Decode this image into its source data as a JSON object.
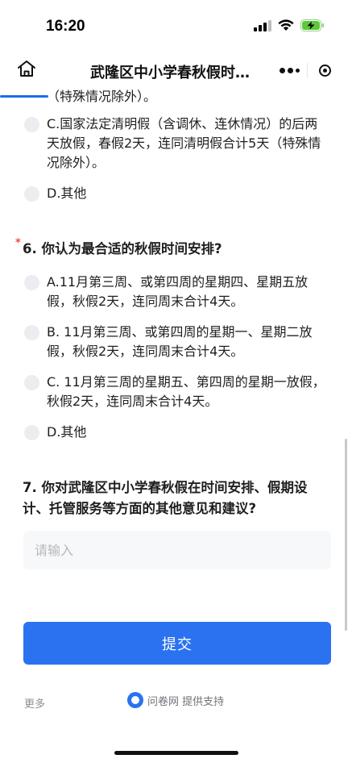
{
  "status_bar": {
    "time": "16:20",
    "signal_icon": "cellular-signal-icon",
    "wifi_icon": "wifi-icon",
    "battery_icon": "battery-charging-icon"
  },
  "nav": {
    "title": "武隆区中小学春秋假时…",
    "home_icon": "home-icon",
    "more_icon": "more-dots-icon",
    "close_icon": "mini-program-close-icon"
  },
  "q5_partial": {
    "option_b_tail": "（特殊情况除外）。",
    "option_c": "C.国家法定清明假（含调休、连休情况）的后两天放假，春假2天，连同清明假合计5天（特殊情况除外）。",
    "option_d": "D.其他"
  },
  "q6": {
    "required_mark": "*",
    "title": "6. 你认为最合适的秋假时间安排?",
    "options": [
      "A.11月第三周、或第四周的星期四、星期五放假，秋假2天，连同周末合计4天。",
      "B. 11月第三周、或第四周的星期一、星期二放假，秋假2天，连同周末合计4天。",
      "C. 11月第三周的星期五、第四周的星期一放假，秋假2天，连同周末合计4天。",
      "D.其他"
    ]
  },
  "q7": {
    "title": "7. 你对武隆区中小学春秋假在时间安排、假期设计、托管服务等方面的其他意见和建议?",
    "placeholder": "请输入",
    "value": ""
  },
  "submit_label": "提交",
  "footer": {
    "more_label": "更多",
    "brand_text": "问卷网 提供支持"
  },
  "colors": {
    "accent": "#2b72f0",
    "required": "#f0483e",
    "radio_fill": "#ebedf0"
  }
}
